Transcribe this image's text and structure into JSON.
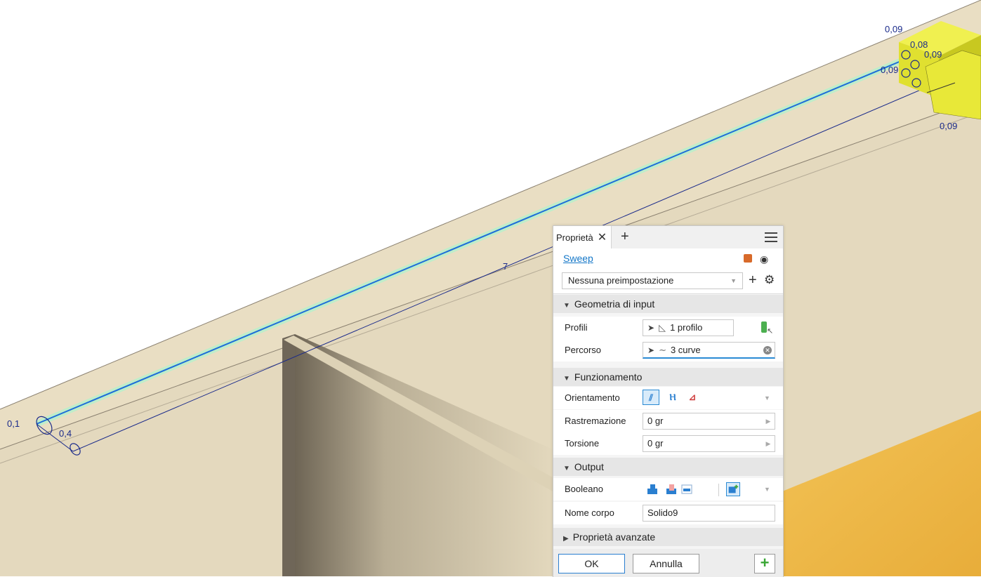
{
  "scene": {
    "dimensions": [
      "0,09",
      "0,08",
      "0,09",
      "0,09",
      "0,09",
      "7",
      "0,1",
      "0,4"
    ]
  },
  "panel": {
    "tab_title": "Proprietà",
    "tab_close_icon": "close-icon",
    "tab_add_icon": "plus-icon",
    "menu_icon": "hamburger-menu-icon",
    "feature_name": "Sweep",
    "preset": "Nessuna preimpostazione",
    "sections": {
      "input": "Geometria di input",
      "behavior": "Funzionamento",
      "output": "Output",
      "advanced": "Proprietà avanzate"
    },
    "rows": {
      "profiles_label": "Profili",
      "profiles_value": "1 profilo",
      "path_label": "Percorso",
      "path_value": "3 curve",
      "orientation_label": "Orientamento",
      "taper_label": "Rastremazione",
      "taper_value": "0 gr",
      "twist_label": "Torsione",
      "twist_value": "0 gr",
      "boolean_label": "Booleano",
      "body_name_label": "Nome corpo",
      "body_name_value": "Solido9"
    },
    "buttons": {
      "ok": "OK",
      "cancel": "Annulla",
      "apply": "+"
    },
    "colors": {
      "accent": "#2a8ad4",
      "link": "#1477c8",
      "apply_green": "#3aa635",
      "annotation_red": "#d90000"
    }
  }
}
